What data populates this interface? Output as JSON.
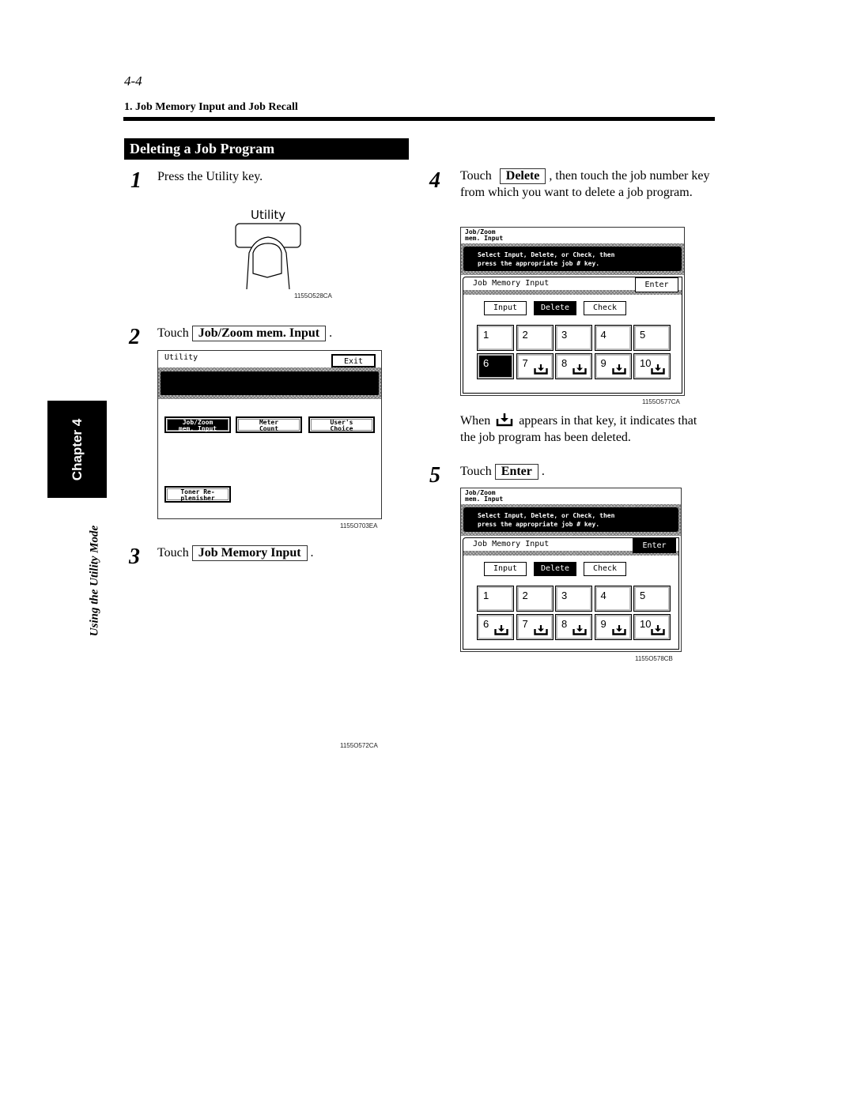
{
  "page": {
    "page_number": "4-4",
    "section_heading": "1. Job Memory Input and Job Recall",
    "title": "Deleting a Job Program",
    "chapter_tab": "Chapter 4",
    "side_label": "Using the Utility Mode"
  },
  "steps": [
    {
      "num": "1",
      "text": "Press the Utility key."
    },
    {
      "num": "2",
      "prefix": "Touch",
      "key": "Job/Zoom mem. Input",
      "suffix": "."
    },
    {
      "num": "3",
      "prefix": "Touch",
      "key": "Job Memory Input",
      "suffix": "."
    },
    {
      "num": "4",
      "prefix": "Touch",
      "key": "Delete",
      "suffix": ", then touch the job number key from which you want to delete a job program."
    },
    {
      "num": "5",
      "prefix": "Touch",
      "key": "Enter",
      "suffix": "."
    }
  ],
  "note": {
    "before": "When",
    "after": "appears in that key, it indicates that the job program has been deleted."
  },
  "figures": {
    "utility_key": {
      "label": "Utility",
      "id": "1155O528CA"
    },
    "utility_screen": {
      "title": "Utility",
      "exit": "Exit",
      "buttons": [
        "Job/Zoom\nmem. Input",
        "Meter\nCount",
        "User's\nChoice",
        "Toner Re-\nplenisher"
      ],
      "id": "1155O703EA"
    },
    "step3_id": "1155O572CA",
    "job_screen": {
      "title": "Job/Zoom\nmem. Input",
      "message_line1": "Select Input, Delete, or Check, then",
      "message_line2": "press the appropriate job # key.",
      "subtitle": "Job Memory Input",
      "enter": "Enter",
      "modes": [
        "Input",
        "Delete",
        "Check"
      ],
      "keys": [
        "1",
        "2",
        "3",
        "4",
        "5",
        "6",
        "7",
        "8",
        "9",
        "10"
      ]
    },
    "screen_a_id": "1155O577CA",
    "screen_b_id": "1155O578CB"
  },
  "icons": {
    "deleted": "deleted-tray-icon"
  }
}
